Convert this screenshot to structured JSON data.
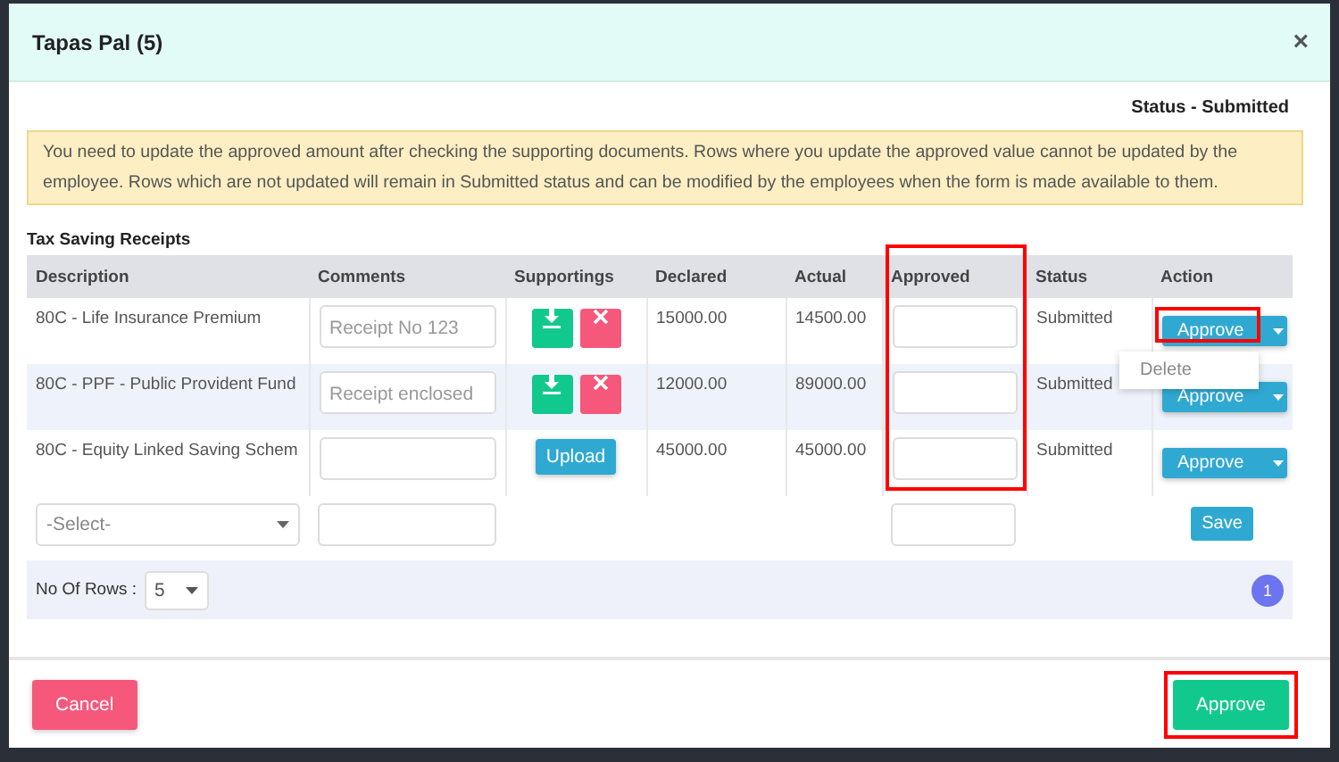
{
  "modal": {
    "title": "Tapas Pal (5)",
    "close": "×",
    "status": "Status - Submitted",
    "alert": "You need to update the approved amount after checking the supporting documents. Rows where you update the approved value cannot be updated by the employee. Rows which are not updated will remain in Submitted status and can be modified by the employees when the form is made available to them.",
    "section_title": "Tax Saving Receipts",
    "table": {
      "columns": [
        {
          "label": "Description",
          "highlighted": false
        },
        {
          "label": "Comments",
          "highlighted": false
        },
        {
          "label": "Supportings",
          "highlighted": false
        },
        {
          "label": "Declared",
          "highlighted": false
        },
        {
          "label": "Actual",
          "highlighted": false
        },
        {
          "label": "Approved",
          "highlighted": true
        },
        {
          "label": "Status",
          "highlighted": false
        },
        {
          "label": "Action",
          "highlighted": false
        }
      ],
      "rows": [
        {
          "description": "80C - Life Insurance Premium",
          "comment": "Receipt No 123",
          "kind": "files",
          "declared": "15000.00",
          "actual": "14500.00",
          "status": "Submitted",
          "action": "Approve",
          "highlighted": true,
          "menu_open": true,
          "menu": [
            "Delete"
          ]
        },
        {
          "description": "80C - PPF - Public Provident Fund",
          "comment": "Receipt enclosed",
          "kind": "files",
          "declared": "12000.00",
          "actual": "89000.00",
          "status": "Submitted",
          "action": "Approve",
          "highlighted": false,
          "menu_open": false,
          "menu": []
        },
        {
          "description": "80C - Equity Linked Saving Schem",
          "kind": "upload",
          "upload_label": "Upload",
          "declared": "45000.00",
          "actual": "45000.00",
          "status": "Submitted",
          "action": "Approve",
          "highlighted": false,
          "menu_open": false,
          "menu": []
        }
      ],
      "new_row": {
        "select_placeholder": "-Select-",
        "save": "Save"
      },
      "rows_label": "No Of Rows :",
      "rows_value": "5",
      "pages": [
        {
          "label": "1",
          "selected": true
        }
      ]
    },
    "cancel": "Cancel",
    "approve": {
      "label": "Approve",
      "highlighted": true
    }
  }
}
